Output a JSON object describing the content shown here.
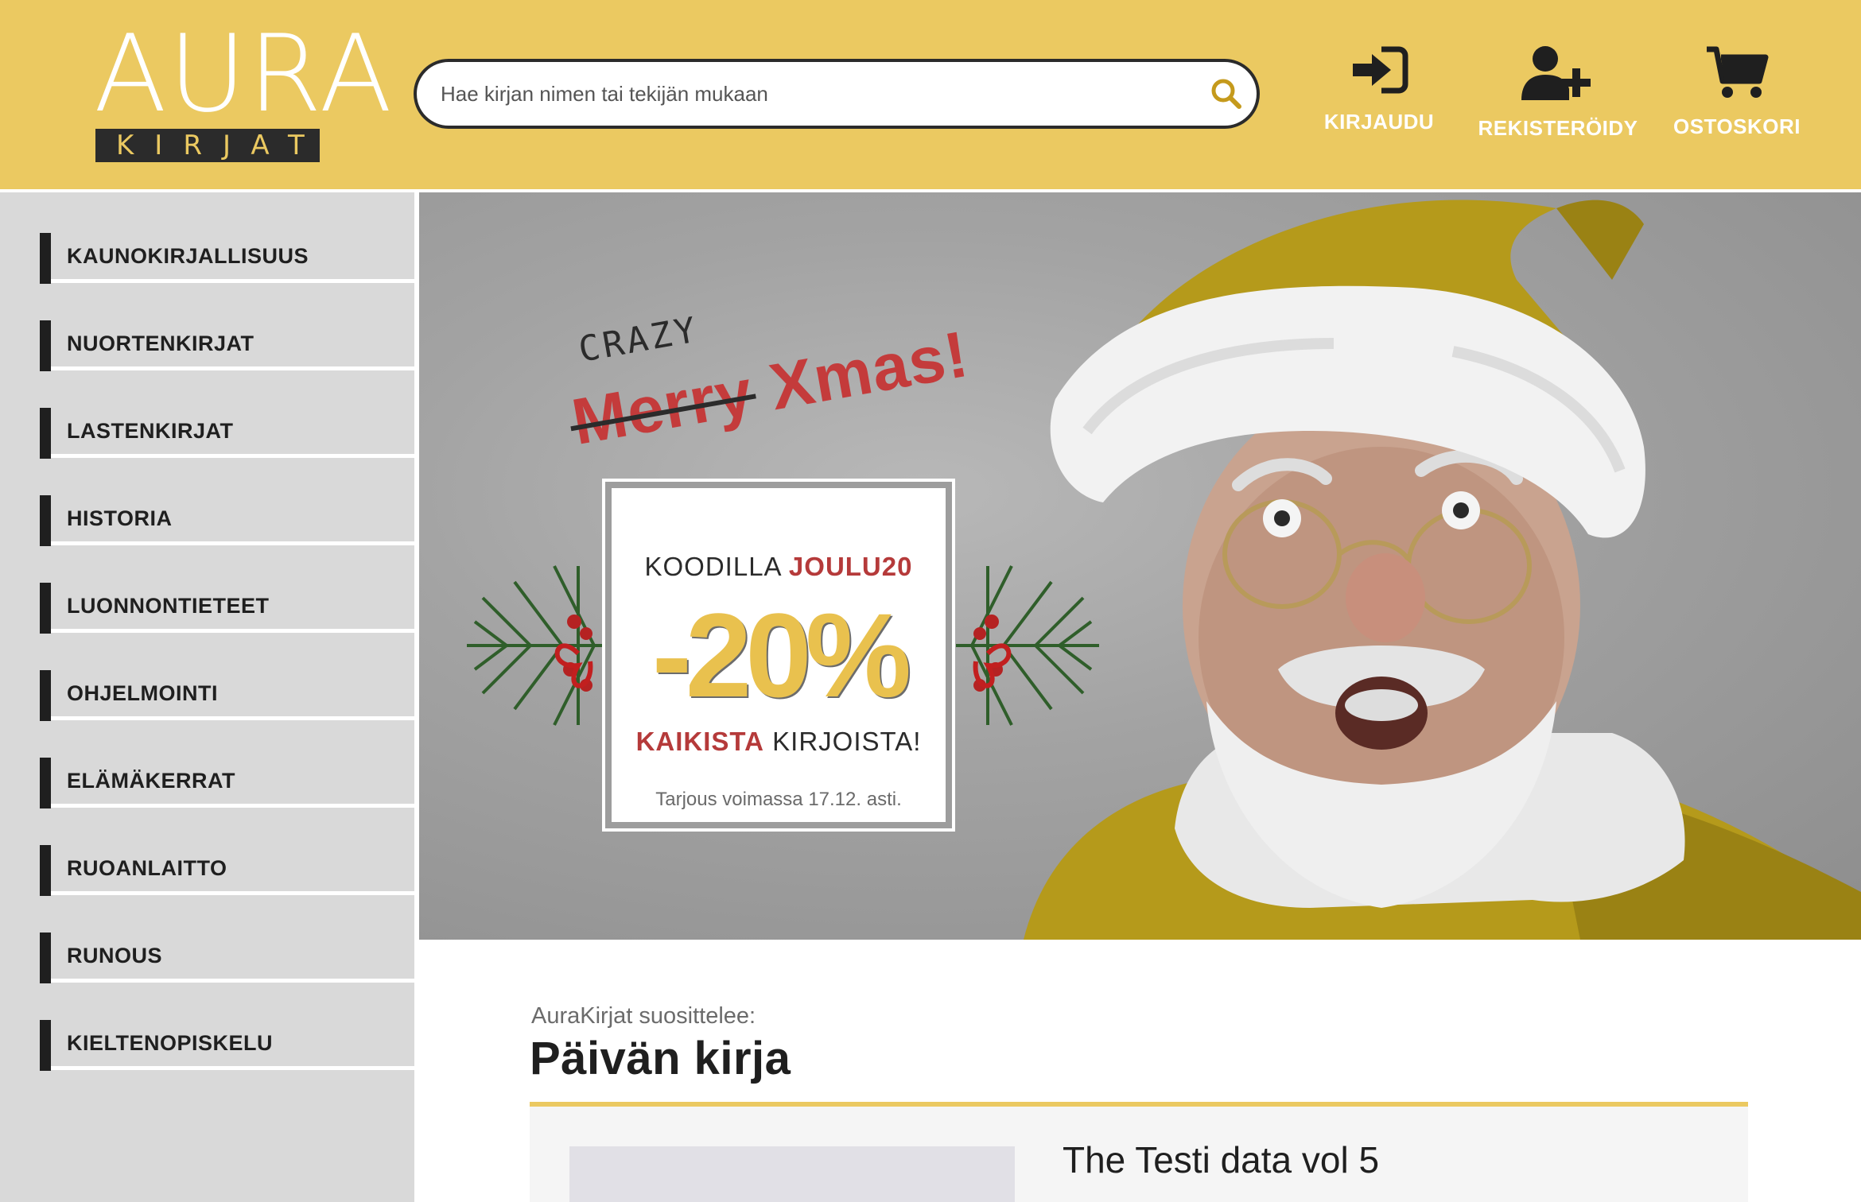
{
  "logo": {
    "main": "AURA",
    "sub": "KIRJAT"
  },
  "search": {
    "placeholder": "Hae kirjan nimen tai tekijän mukaan"
  },
  "header_actions": [
    {
      "label": "KIRJAUDU",
      "icon": "login-icon"
    },
    {
      "label": "REKISTERÖIDY",
      "icon": "add-user-icon"
    },
    {
      "label": "OSTOSKORI",
      "icon": "cart-icon"
    }
  ],
  "categories": [
    "KAUNOKIRJALLISUUS",
    "NUORTENKIRJAT",
    "LASTENKIRJAT",
    "HISTORIA",
    "LUONNONTIETEET",
    "OHJELMOINTI",
    "ELÄMÄKERRAT",
    "RUOANLAITTO",
    "RUNOUS",
    "KIELTENOPISKELU"
  ],
  "hero": {
    "crazy": "CRAZY",
    "merry": "Merry",
    "xmas": "Xmas!",
    "promo_prefix": "KOODILLA",
    "promo_code": "JOULU20",
    "promo_discount": "-20%",
    "promo_all": "KAIKISTA",
    "promo_books": "KIRJOISTA!",
    "promo_valid": "Tarjous voimassa 17.12. asti."
  },
  "recommend": {
    "subtitle": "AuraKirjat suosittelee:",
    "title": "Päivän kirja",
    "book_title": "The Testi data vol 5"
  },
  "colors": {
    "brand_yellow": "#ebc961",
    "dark": "#1f1f1f",
    "promo_red": "#b53a3a",
    "sidebar_bg": "#d9d9d9"
  }
}
